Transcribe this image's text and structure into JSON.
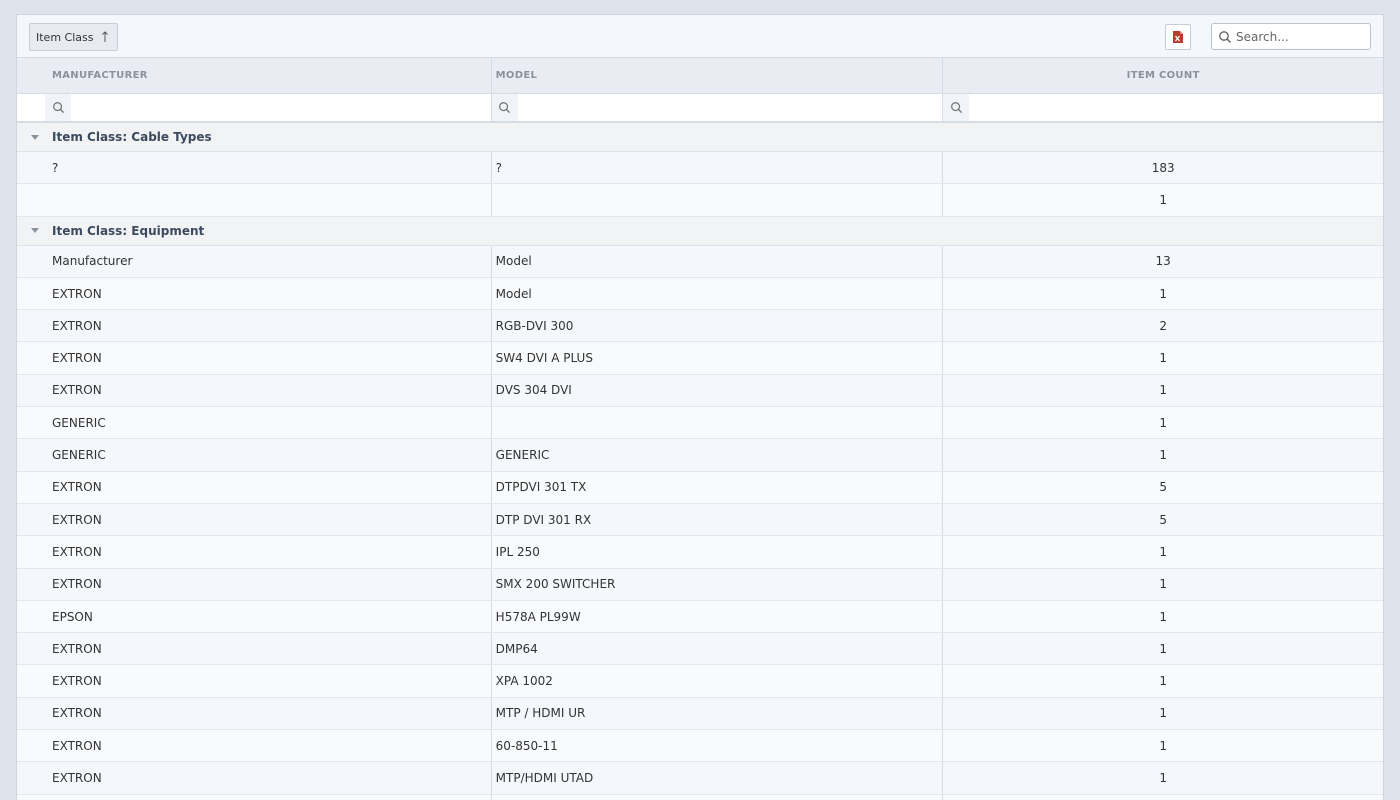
{
  "toolbar": {
    "group_chip_label": "Item Class",
    "search_placeholder": "Search..."
  },
  "columns": {
    "manufacturer": "MANUFACTURER",
    "model": "MODEL",
    "item_count": "ITEM COUNT"
  },
  "groups": [
    {
      "label": "Item Class: Cable Types",
      "rows": [
        {
          "manufacturer": "?",
          "model": "?",
          "count": "183"
        },
        {
          "manufacturer": "",
          "model": "",
          "count": "1"
        }
      ]
    },
    {
      "label": "Item Class: Equipment",
      "rows": [
        {
          "manufacturer": "Manufacturer",
          "model": "Model",
          "count": "13"
        },
        {
          "manufacturer": "EXTRON",
          "model": "Model",
          "count": "1"
        },
        {
          "manufacturer": "EXTRON",
          "model": "RGB-DVI 300",
          "count": "2"
        },
        {
          "manufacturer": "EXTRON",
          "model": "SW4 DVI A PLUS",
          "count": "1"
        },
        {
          "manufacturer": "EXTRON",
          "model": "DVS 304 DVI",
          "count": "1"
        },
        {
          "manufacturer": "GENERIC",
          "model": "",
          "count": "1"
        },
        {
          "manufacturer": "GENERIC",
          "model": "GENERIC",
          "count": "1"
        },
        {
          "manufacturer": "EXTRON",
          "model": "DTPDVI 301 TX",
          "count": "5"
        },
        {
          "manufacturer": "EXTRON",
          "model": "DTP DVI 301 RX",
          "count": "5"
        },
        {
          "manufacturer": "EXTRON",
          "model": "IPL 250",
          "count": "1"
        },
        {
          "manufacturer": "EXTRON",
          "model": "SMX 200 SWITCHER",
          "count": "1"
        },
        {
          "manufacturer": "EPSON",
          "model": "H578A PL99W",
          "count": "1"
        },
        {
          "manufacturer": "EXTRON",
          "model": "DMP64",
          "count": "1"
        },
        {
          "manufacturer": "EXTRON",
          "model": "XPA 1002",
          "count": "1"
        },
        {
          "manufacturer": "EXTRON",
          "model": "MTP / HDMI UR",
          "count": "1"
        },
        {
          "manufacturer": "EXTRON",
          "model": "60-850-11",
          "count": "1"
        },
        {
          "manufacturer": "EXTRON",
          "model": "MTP/HDMI UTAD",
          "count": "1"
        },
        {
          "manufacturer": "",
          "model": "",
          "count": ""
        }
      ]
    }
  ],
  "icons": {
    "export": "excel-export-icon",
    "search": "search-icon",
    "sort": "sort-ascending-icon",
    "caret": "caret-down-icon"
  },
  "colors": {
    "export_icon": "#c0392b",
    "group_text": "#3b4a5c",
    "header_text": "#8a929e"
  }
}
